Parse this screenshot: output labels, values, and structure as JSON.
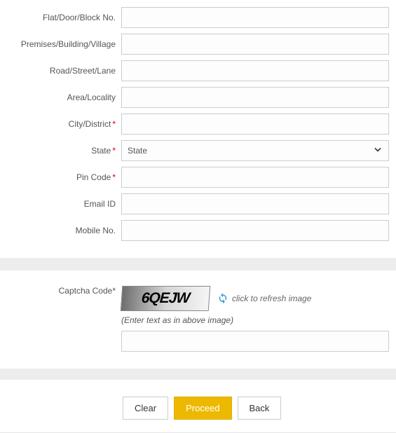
{
  "fields": {
    "flat": {
      "label": "Flat/Door/Block No.",
      "value": "",
      "required": false
    },
    "premises": {
      "label": "Premises/Building/Village",
      "value": "",
      "required": false
    },
    "road": {
      "label": "Road/Street/Lane",
      "value": "",
      "required": false
    },
    "area": {
      "label": "Area/Locality",
      "value": "",
      "required": false
    },
    "city": {
      "label": "City/District",
      "value": "",
      "required": true
    },
    "state": {
      "label": "State",
      "selected": "State",
      "required": true
    },
    "pin": {
      "label": "Pin Code",
      "value": "",
      "required": true
    },
    "email": {
      "label": "Email ID",
      "value": "",
      "required": false
    },
    "mobile": {
      "label": "Mobile No.",
      "value": "",
      "required": false
    }
  },
  "captcha": {
    "label": "Captcha Code",
    "image_text": "6QEJW",
    "refresh_text": "click to refresh image",
    "hint": "(Enter text as in above image)",
    "value": ""
  },
  "buttons": {
    "clear": "Clear",
    "proceed": "Proceed",
    "back": "Back"
  },
  "required_marker": "*"
}
